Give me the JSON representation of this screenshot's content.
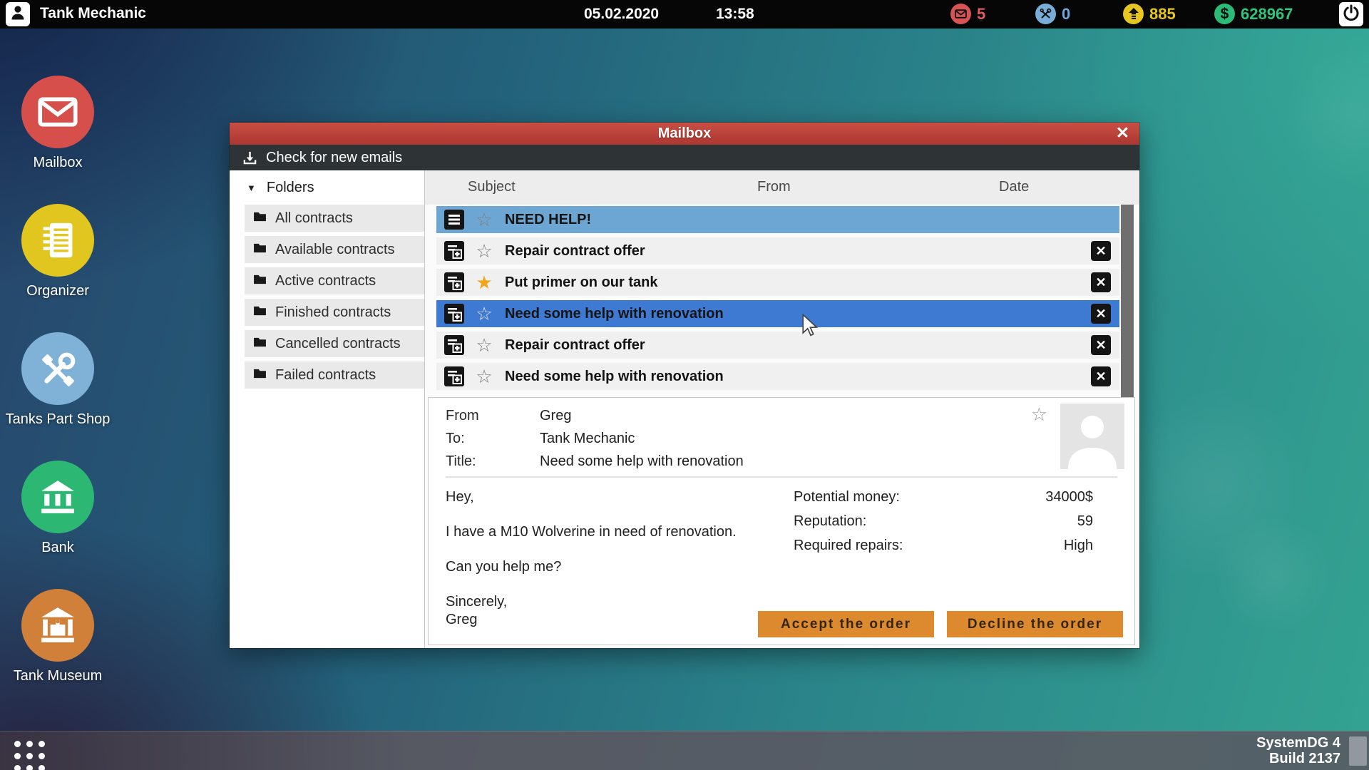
{
  "top_bar": {
    "app_title": "Tank Mechanic",
    "date": "05.02.2020",
    "time": "13:58",
    "mail_count": "5",
    "repairs_count": "0",
    "coins_count": "885",
    "money_count": "628967",
    "colors": {
      "mail": "#d85454",
      "repairs": "#79add9",
      "coins": "#e5c520",
      "money": "#2cbb77"
    }
  },
  "desktop_icons": [
    {
      "label": "Mailbox",
      "color": "#d64f4b"
    },
    {
      "label": "Organizer",
      "color": "#e2c620"
    },
    {
      "label": "Tanks Part Shop",
      "color": "#7fb2d6"
    },
    {
      "label": "Bank",
      "color": "#2cb873"
    },
    {
      "label": "Tank Museum",
      "color": "#d08038"
    }
  ],
  "mailbox_window": {
    "title": "Mailbox",
    "toolbar": {
      "check_for_new_emails": "Check for new emails"
    },
    "folders": {
      "header": "Folders",
      "items": [
        "All contracts",
        "Available contracts",
        "Active contracts",
        "Finished contracts",
        "Cancelled contracts",
        "Failed contracts"
      ]
    },
    "list": {
      "columns": {
        "subject": "Subject",
        "from": "From",
        "date": "Date"
      },
      "rows": [
        {
          "subject": "NEED HELP!",
          "selected": "light",
          "starred": false,
          "closable": false
        },
        {
          "subject": "Repair contract offer",
          "selected": "none",
          "starred": false,
          "closable": true
        },
        {
          "subject": "Put primer on our tank",
          "selected": "none",
          "starred": true,
          "closable": true
        },
        {
          "subject": "Need some help with renovation",
          "selected": "strong",
          "starred": false,
          "closable": true
        },
        {
          "subject": "Repair contract offer",
          "selected": "none",
          "starred": false,
          "closable": true
        },
        {
          "subject": "Need some help with renovation",
          "selected": "none",
          "starred": false,
          "closable": true
        }
      ]
    },
    "detail": {
      "from_label": "From",
      "from_value": "Greg",
      "to_label": "To:",
      "to_value": "Tank Mechanic",
      "title_label": "Title:",
      "title_value": "Need some help with renovation",
      "body": [
        "Hey,",
        "I have a M10 Wolverine in need of renovation.",
        "Can you help me?",
        "Sincerely,",
        "Greg"
      ],
      "stats": [
        {
          "label": "Potential money:",
          "value": "34000$"
        },
        {
          "label": "Reputation:",
          "value": "59"
        },
        {
          "label": "Required repairs:",
          "value": "High"
        }
      ],
      "accept_button": "Accept the order",
      "decline_button": "Decline the order"
    }
  },
  "icons": {
    "star_filled": "★",
    "star_outline": "☆",
    "close": "✕",
    "caret_down": "▼",
    "dollar": "$"
  },
  "taskbar": {
    "system_name": "SystemDG 4",
    "system_build": "Build 2137"
  }
}
